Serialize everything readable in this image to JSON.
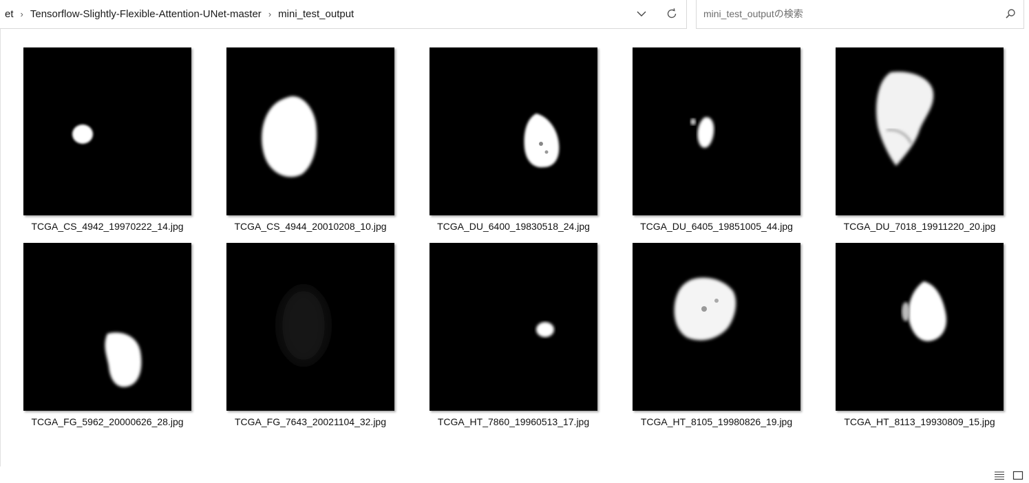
{
  "address": {
    "breadcrumbs": [
      "et",
      "Tensorflow-Slightly-Flexible-Attention-UNet-master",
      "mini_test_output"
    ],
    "dropdown_icon": "chevron-down-icon",
    "refresh_icon": "refresh-icon"
  },
  "search": {
    "placeholder": "mini_test_outputの検索",
    "icon": "search-icon"
  },
  "files": [
    {
      "name": "TCGA_CS_4942_19970222_14.jpg"
    },
    {
      "name": "TCGA_CS_4944_20010208_10.jpg"
    },
    {
      "name": "TCGA_DU_6400_19830518_24.jpg"
    },
    {
      "name": "TCGA_DU_6405_19851005_44.jpg"
    },
    {
      "name": "TCGA_DU_7018_19911220_20.jpg"
    },
    {
      "name": "TCGA_FG_5962_20000626_28.jpg"
    },
    {
      "name": "TCGA_FG_7643_20021104_32.jpg"
    },
    {
      "name": "TCGA_HT_7860_19960513_17.jpg"
    },
    {
      "name": "TCGA_HT_8105_19980826_19.jpg"
    },
    {
      "name": "TCGA_HT_8113_19930809_15.jpg"
    }
  ],
  "statusbar": {
    "details_view_icon": "details-view-icon",
    "large_icons_view_icon": "large-icons-view-icon"
  }
}
